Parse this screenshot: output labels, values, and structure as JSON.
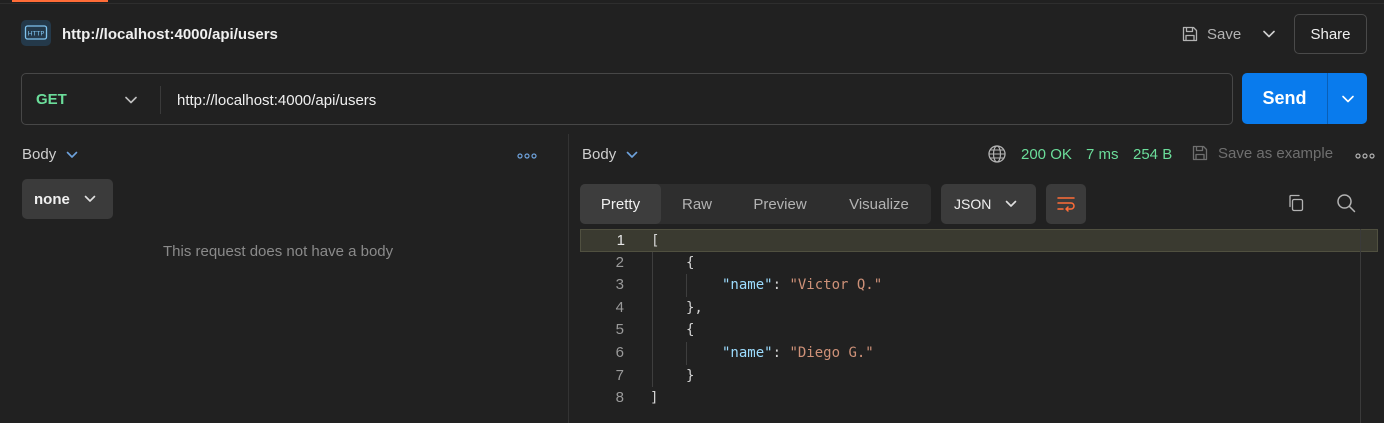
{
  "colors": {
    "accent": "#ff6c37",
    "method_get": "#6bdd9a",
    "send": "#097bed",
    "status_ok": "#6bdd9a",
    "link_blue": "#6ea2dc"
  },
  "header": {
    "icon_text": "HTTP",
    "title": "http://localhost:4000/api/users",
    "save_label": "Save",
    "share_label": "Share"
  },
  "request": {
    "method": "GET",
    "url": "http://localhost:4000/api/users",
    "send_label": "Send"
  },
  "request_body": {
    "label": "Body",
    "type": "none",
    "empty_message": "This request does not have a body"
  },
  "response": {
    "label": "Body",
    "status": "200 OK",
    "time": "7 ms",
    "size": "254 B",
    "save_example_label": "Save as example",
    "tabs": [
      {
        "label": "Pretty",
        "active": true
      },
      {
        "label": "Raw",
        "active": false
      },
      {
        "label": "Preview",
        "active": false
      },
      {
        "label": "Visualize",
        "active": false
      }
    ],
    "format": "JSON",
    "lines": [
      {
        "num": "1",
        "indent": 0,
        "tokens": [
          {
            "t": "[",
            "c": "brk"
          }
        ]
      },
      {
        "num": "2",
        "indent": 1,
        "tokens": [
          {
            "t": "{",
            "c": "brk"
          }
        ]
      },
      {
        "num": "3",
        "indent": 2,
        "tokens": [
          {
            "t": "\"name\"",
            "c": "key"
          },
          {
            "t": ": ",
            "c": "brk"
          },
          {
            "t": "\"Victor Q.\"",
            "c": "str"
          }
        ]
      },
      {
        "num": "4",
        "indent": 1,
        "tokens": [
          {
            "t": "},",
            "c": "brk"
          }
        ]
      },
      {
        "num": "5",
        "indent": 1,
        "tokens": [
          {
            "t": "{",
            "c": "brk"
          }
        ]
      },
      {
        "num": "6",
        "indent": 2,
        "tokens": [
          {
            "t": "\"name\"",
            "c": "key"
          },
          {
            "t": ": ",
            "c": "brk"
          },
          {
            "t": "\"Diego G.\"",
            "c": "str"
          }
        ]
      },
      {
        "num": "7",
        "indent": 1,
        "tokens": [
          {
            "t": "}",
            "c": "brk"
          }
        ]
      },
      {
        "num": "8",
        "indent": 0,
        "tokens": [
          {
            "t": "]",
            "c": "brk"
          }
        ]
      }
    ]
  }
}
